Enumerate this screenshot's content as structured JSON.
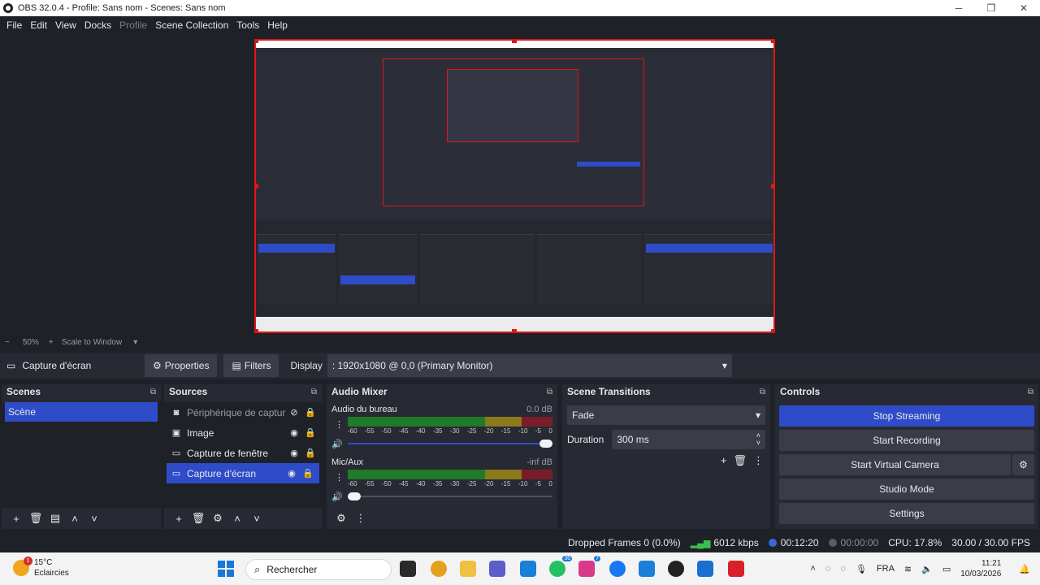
{
  "window": {
    "title": "OBS 32.0.4 - Profile: Sans nom - Scenes: Sans nom"
  },
  "menu": {
    "items": [
      "File",
      "Edit",
      "View",
      "Docks",
      "Profile",
      "Scene Collection",
      "Tools",
      "Help"
    ]
  },
  "zoom": {
    "minus": "−",
    "level": "50%",
    "plus": "+",
    "mode": "Scale to Window"
  },
  "source_toolbar": {
    "source_name": "Capture d'écran",
    "properties_label": "Properties",
    "filters_label": "Filters",
    "display_label": "Display",
    "display_value": ": 1920x1080 @ 0,0 (Primary Monitor)"
  },
  "scenes": {
    "title": "Scenes",
    "items": [
      "Scène"
    ]
  },
  "sources": {
    "title": "Sources",
    "items": [
      {
        "label": "Périphérique de capture",
        "icon": "camera-icon"
      },
      {
        "label": "Image",
        "icon": "image-icon"
      },
      {
        "label": "Capture de fenêtre",
        "icon": "window-icon"
      },
      {
        "label": "Capture d'écran",
        "icon": "monitor-icon"
      }
    ]
  },
  "audio_mixer": {
    "title": "Audio Mixer",
    "scale": [
      "-60",
      "-55",
      "-50",
      "-45",
      "-40",
      "-35",
      "-30",
      "-25",
      "-20",
      "-15",
      "-10",
      "-5",
      "0"
    ],
    "channels": [
      {
        "name": "Audio du bureau",
        "db": "0.0 dB",
        "volume": 1.0
      },
      {
        "name": "Mic/Aux",
        "db": "-inf dB",
        "volume": 0.0
      }
    ]
  },
  "scene_transitions": {
    "title": "Scene Transitions",
    "transition": "Fade",
    "duration_label": "Duration",
    "duration_value": "300 ms"
  },
  "controls": {
    "title": "Controls",
    "stop_streaming": "Stop Streaming",
    "start_recording": "Start Recording",
    "start_virtual_camera": "Start Virtual Camera",
    "studio_mode": "Studio Mode",
    "settings": "Settings"
  },
  "status": {
    "dropped_frames": "Dropped Frames 0 (0.0%)",
    "bitrate": "6012 kbps",
    "stream_time": "00:12:20",
    "record_time": "00:00:00",
    "cpu": "CPU: 17.8%",
    "fps": "30.00 / 30.00 FPS"
  },
  "taskbar": {
    "weather_temp": "15°C",
    "weather_desc": "Eclaircies",
    "weather_badge": "1",
    "search_placeholder": "Rechercher",
    "language": "FRA",
    "time": "11:21",
    "date": "10/03/2026",
    "badge_a": "36",
    "badge_b": "7"
  },
  "colors": {
    "accent": "#2f4cc8",
    "selection_red": "#e01515",
    "panel": "#272a33",
    "background": "#1f2128"
  }
}
